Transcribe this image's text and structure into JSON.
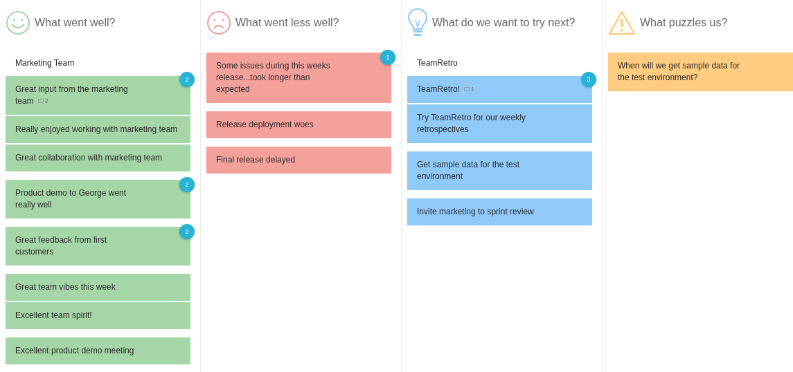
{
  "columns": [
    {
      "kind": "smile",
      "title": "What went well?",
      "color": "#a5d6a7",
      "groups": [
        {
          "title": "Marketing Team",
          "badge": "2",
          "cards": [
            {
              "text": "Great input from the marketing\nteam",
              "comments": "2"
            },
            {
              "text": "Really enjoyed working with marketing team"
            },
            {
              "text": "Great collaboration with marketing team"
            }
          ]
        },
        {
          "badge": "2",
          "cards": [
            {
              "text": "Product demo to George went\nreally well"
            }
          ]
        },
        {
          "badge": "2",
          "cards": [
            {
              "text": "Great feedback from first\ncustomers"
            }
          ]
        },
        {
          "cards": [
            {
              "text": "Great team vibes this week"
            },
            {
              "text": "Excellent team spirit!"
            }
          ]
        },
        {
          "cards": [
            {
              "text": "Excellent product demo meeting"
            }
          ]
        }
      ]
    },
    {
      "kind": "frown",
      "title": "What went less well?",
      "color": "#f4a19c",
      "groups": [
        {
          "badge": "1",
          "cards": [
            {
              "text": "Some issues during this weeks\nrelease...took longer than\nexpected"
            }
          ]
        },
        {
          "cards": [
            {
              "text": "Release deployment woes"
            }
          ]
        },
        {
          "cards": [
            {
              "text": "Final release delayed"
            }
          ]
        }
      ]
    },
    {
      "kind": "bulb",
      "title": "What do we want to try next?",
      "color": "#90caf9",
      "groups": [
        {
          "title": "TeamRetro",
          "badge": "3",
          "cards": [
            {
              "text": "TeamRetro!",
              "comments": "1"
            },
            {
              "text": "Try TeamRetro for our weekly\nretrospectives"
            }
          ]
        },
        {
          "cards": [
            {
              "text": "Get sample data for the test\nenvironment"
            }
          ]
        },
        {
          "cards": [
            {
              "text": "Invite marketing to sprint review"
            }
          ]
        }
      ]
    },
    {
      "kind": "warning",
      "title": "What puzzles us?",
      "color": "#ffcc80",
      "groups": [
        {
          "cards": [
            {
              "text": "When will we get sample data for\nthe test environment?"
            }
          ]
        }
      ]
    }
  ]
}
